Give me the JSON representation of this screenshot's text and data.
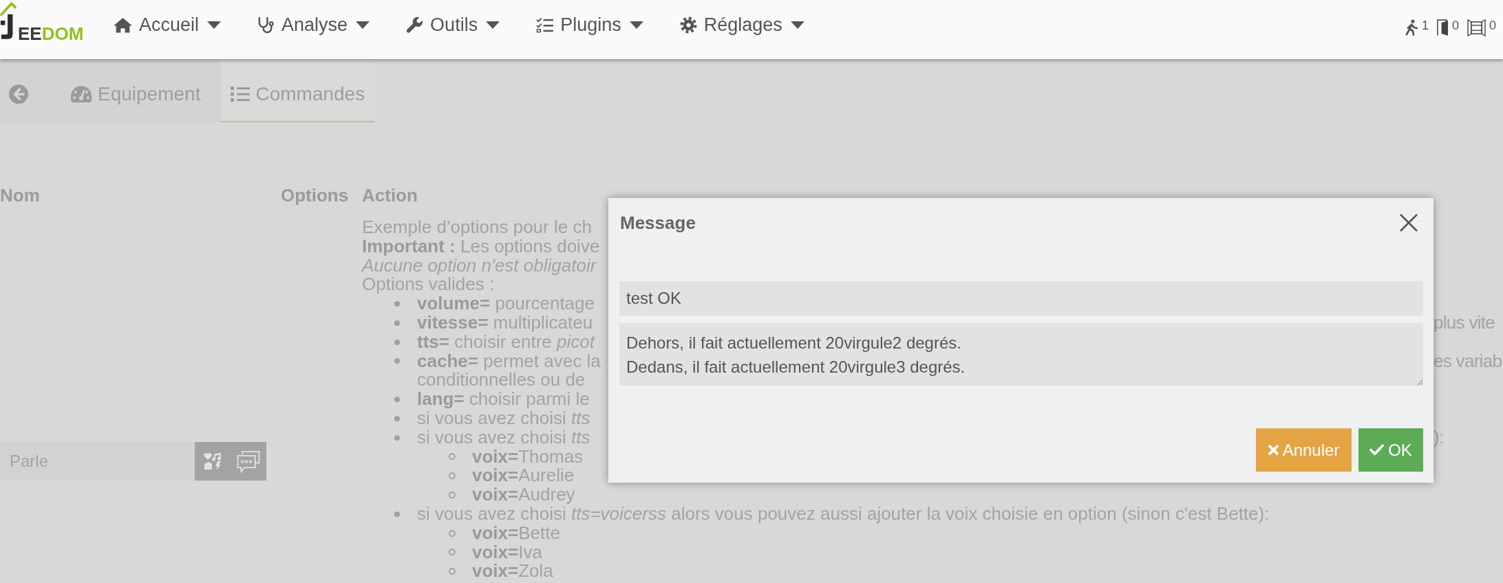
{
  "navbar": {
    "logo": {
      "parts": [
        {
          "text": "EE",
          "color": "#3a3a3a"
        },
        {
          "text": "DOM",
          "color": "#93c01f"
        }
      ]
    },
    "menus": [
      {
        "kind": "home",
        "label": "Accueil"
      },
      {
        "kind": "analysis",
        "label": "Analyse"
      },
      {
        "kind": "tools",
        "label": "Outils"
      },
      {
        "kind": "plugins",
        "label": "Plugins"
      },
      {
        "kind": "settings",
        "label": "Réglages"
      }
    ],
    "summary": [
      {
        "kind": "motion",
        "count": "1"
      },
      {
        "kind": "door",
        "count": "0"
      },
      {
        "kind": "window",
        "count": "0"
      }
    ]
  },
  "tabs": [
    {
      "kind": "equipment",
      "label": "Equipement",
      "selected": false
    },
    {
      "kind": "commands",
      "label": "Commandes",
      "selected": true
    }
  ],
  "commands_table": {
    "columns": [
      {
        "label": "Nom"
      },
      {
        "label": "Options"
      },
      {
        "label": "Action"
      }
    ],
    "rows": [
      {
        "name": "Parle",
        "action_help": [
          {
            "kind": "text",
            "text": "Exemple d’options pour le ch"
          },
          {
            "kind": "text",
            "text": "**Important :** Les options doive"
          },
          {
            "kind": "note",
            "text": "Aucune option n'est obligatoir"
          },
          {
            "kind": "text",
            "text": "Options valides :"
          },
          {
            "kind": "bullet",
            "text": "**volume=** pourcentage"
          },
          {
            "kind": "bullet",
            "text": "**vitesse=** multiplicateu",
            "tail": "plus vite"
          },
          {
            "kind": "bullet",
            "text": "**tts=** choisir entre *picot*"
          },
          {
            "kind": "bullet",
            "text": "**cache=** permet avec la",
            "tail": "es variab",
            "continuation": "conditionnelles ou de"
          },
          {
            "kind": "bullet",
            "text": "**lang=** choisir parmi le"
          },
          {
            "kind": "bullet",
            "text": "si vous avez choisi *tts*"
          },
          {
            "kind": "bullet",
            "text": "si vous avez choisi *tts*",
            "tail": "):"
          },
          {
            "kind": "sub_bullet",
            "text": "**voix=**Thomas"
          },
          {
            "kind": "sub_bullet",
            "text": "**voix=**Aurelie"
          },
          {
            "kind": "sub_bullet",
            "text": "**voix=**Audrey"
          },
          {
            "kind": "bullet",
            "text": "si vous avez choisi *tts=voicerss* alors vous pouvez aussi ajouter la voix choisie en option (sinon c'est Bette):"
          },
          {
            "kind": "sub_bullet",
            "text": "**voix=**Bette"
          },
          {
            "kind": "sub_bullet",
            "text": "**voix=**Iva"
          },
          {
            "kind": "sub_bullet",
            "text": "**voix=**Zola"
          }
        ]
      }
    ]
  },
  "modal": {
    "title": "Message",
    "fields": [
      {
        "kind": "input",
        "value": "test OK"
      },
      {
        "kind": "textarea",
        "value": "Dehors, il fait actuellement 20virgule2 degrés.\nDedans, il fait actuellement 20virgule3 degrés."
      }
    ],
    "buttons": [
      {
        "kind": "cancel",
        "label": "Annuler"
      },
      {
        "kind": "confirm",
        "label": "OK"
      }
    ]
  }
}
